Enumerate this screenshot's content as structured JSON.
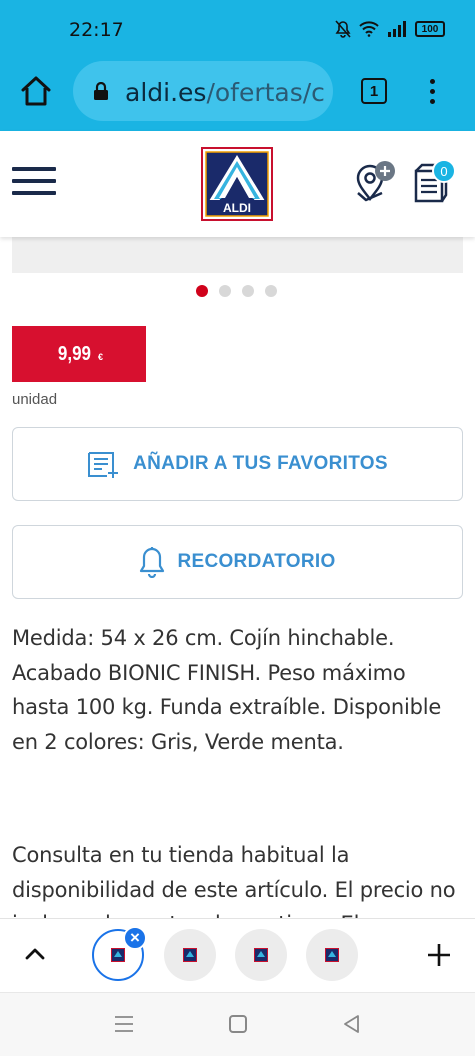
{
  "status_bar": {
    "time": "22:17",
    "battery": "100",
    "icons": [
      "mute-icon",
      "wifi-icon",
      "signal-icon",
      "battery-icon"
    ]
  },
  "browser": {
    "url_host": "aldi.es",
    "url_path": "/ofertas/c",
    "tab_count": "1"
  },
  "site_header": {
    "logo_text": "ALDI",
    "list_count": "0"
  },
  "carousel": {
    "total": 4,
    "active": 1
  },
  "product": {
    "price": "9,99",
    "currency": "€",
    "unit": "unidad",
    "favorites_label": "AÑADIR A TUS FAVORITOS",
    "reminder_label": "RECORDATORIO",
    "description": "Medida: 54 x 26 cm. Cojín hinchable. Acabado BIONIC FINISH. Peso máximo hasta 100 kg. Funda extraíble. Disponible en 2 colores: Gris, Verde menta.",
    "availability": "Consulta en tu tienda habitual la disponibilidad de este artículo. El precio no incluye elementos decorativos. El"
  },
  "colors": {
    "browser_bar": "#1ab4e3",
    "aldi_red": "#d7102f",
    "action_blue": "#3a8fd0",
    "tab_blue": "#1a73e8"
  }
}
